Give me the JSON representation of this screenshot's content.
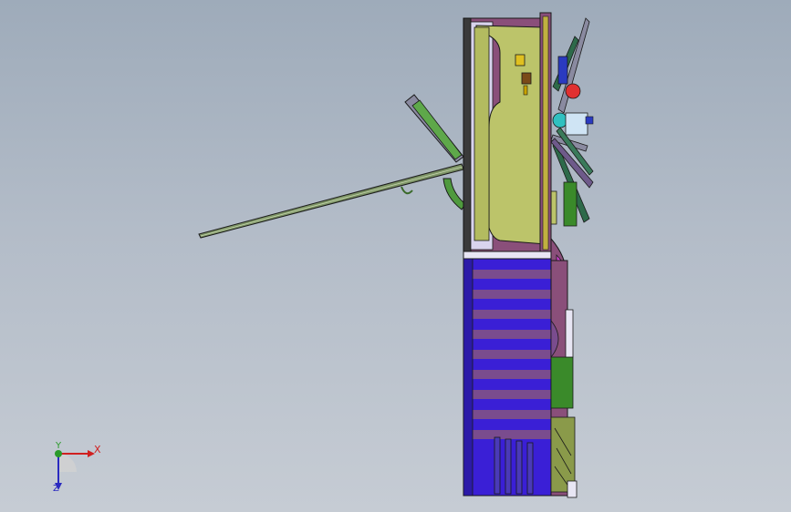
{
  "viewport": {
    "background_top": "#9eabba",
    "background_bottom": "#c6ccd4"
  },
  "model": {
    "colors": {
      "housing_purple": "#8a4f7a",
      "panel_olive": "#bcc46a",
      "panel_lavender": "#d9d4ee",
      "blue_stripe": "#3a1fd6",
      "mauve_stripe": "#7a4c8e",
      "green_part": "#3a8a2a",
      "rod": "#6e8a5a",
      "outline": "#1a1a1a"
    }
  },
  "triad": {
    "x_label": "X",
    "y_label": "Y",
    "z_label": "Z",
    "x_color": "#d02020",
    "y_color": "#2a9a2a",
    "z_color": "#2a2ac0"
  }
}
